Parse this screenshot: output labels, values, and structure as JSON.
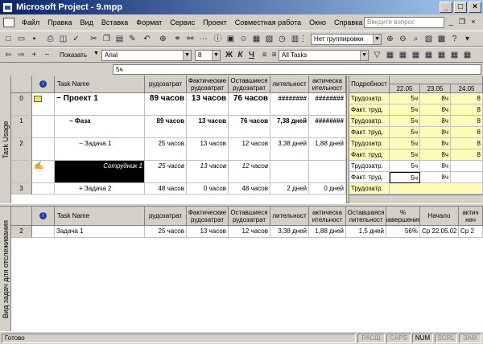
{
  "window": {
    "title": "Microsoft Project - 9.mpp"
  },
  "menu": {
    "items": [
      "Файл",
      "Правка",
      "Вид",
      "Вставка",
      "Формат",
      "Сервис",
      "Проект",
      "Совместная работа",
      "Окно",
      "Справка"
    ],
    "ask_placeholder": "Введите вопрос"
  },
  "toolbar1": {
    "group_select": "Нет группировки"
  },
  "toolbar2": {
    "show_label": "Показать",
    "font": "Arial",
    "size": "8",
    "bold": "Ж",
    "italic": "К",
    "underline": "Ч",
    "filter": "All Tasks"
  },
  "entry": {
    "value": "5ч"
  },
  "usage": {
    "view_label": "Task Usage",
    "headers": [
      "Task Name",
      "рудозатрат",
      "Фактические рудозатрат",
      "Оставшиеся рудозатрат",
      "лительност",
      "актическа ительност"
    ],
    "details_header": "Подробност",
    "dates": [
      "22.05",
      "23.05",
      "24.05"
    ],
    "rows": [
      {
        "num": "0",
        "name": "Проект 1",
        "work": "89 часов",
        "act_work": "13 часов",
        "rem_work": "76 часов",
        "dur": "########",
        "act_dur": "########",
        "details": [
          "Трудозатр.",
          "Факт. труд."
        ],
        "vals": [
          [
            "5ч",
            "8ч",
            "8"
          ],
          [
            "5ч",
            "8ч",
            "8"
          ]
        ]
      },
      {
        "num": "1",
        "name": "Фаза",
        "work": "89 часов",
        "act_work": "13 часов",
        "rem_work": "76 часов",
        "dur": "7,38 дней",
        "act_dur": "########",
        "details": [
          "Трудозатр.",
          "Факт. труд."
        ],
        "vals": [
          [
            "5ч",
            "8ч",
            "8"
          ],
          [
            "5ч",
            "8ч",
            "8"
          ]
        ]
      },
      {
        "num": "2",
        "name": "Задача 1",
        "work": "25 часов",
        "act_work": "13 часов",
        "rem_work": "12 часов",
        "dur": "3,38 дней",
        "act_dur": "1,88 дней",
        "details": [
          "Трудозатр.",
          "Факт. труд."
        ],
        "vals": [
          [
            "5ч",
            "8ч",
            "8"
          ],
          [
            "5ч",
            "8ч",
            "8"
          ]
        ]
      },
      {
        "num": "",
        "name": "Сотрудник 1",
        "work": "25 часов",
        "act_work": "13 часов",
        "rem_work": "12 часов",
        "dur": "",
        "act_dur": "",
        "details": [
          "Трудозатр.",
          "Факт. труд."
        ],
        "vals": [
          [
            "5ч",
            "8ч",
            ""
          ],
          [
            "5ч",
            "8ч",
            ""
          ]
        ]
      },
      {
        "num": "3",
        "name": "Задача 2",
        "work": "48 часов",
        "act_work": "0 часов",
        "rem_work": "48 часов",
        "dur": "2 дней",
        "act_dur": "0 дней",
        "details": [
          "Трудозатр."
        ],
        "vals": [
          [
            "",
            "",
            ""
          ]
        ]
      }
    ]
  },
  "tracking": {
    "view_label": "Вид задач для отслеживания",
    "headers": [
      "Task Name",
      "рудозатрат",
      "Фактические рудозатрат",
      "Оставшиеся рудозатрат",
      "лительност",
      "актическа ительност",
      "Оставшаяся лительност",
      "% завершения",
      "Начало",
      "актич нач"
    ],
    "row": {
      "num": "2",
      "name": "Задача 1",
      "work": "25 часов",
      "act_work": "13 часов",
      "rem_work": "12 часов",
      "dur": "3,38 дней",
      "act_dur": "1,88 дней",
      "rem_dur": "1,5 дней",
      "pct": "56%",
      "start": "Ср 22.05.02",
      "act_start": "Ср 2"
    }
  },
  "status": {
    "ready": "Готово",
    "ext": "РАСШ",
    "caps": "CAPS",
    "num": "NUM",
    "scrl": "SCRL",
    "zam": "ЗАМ"
  }
}
